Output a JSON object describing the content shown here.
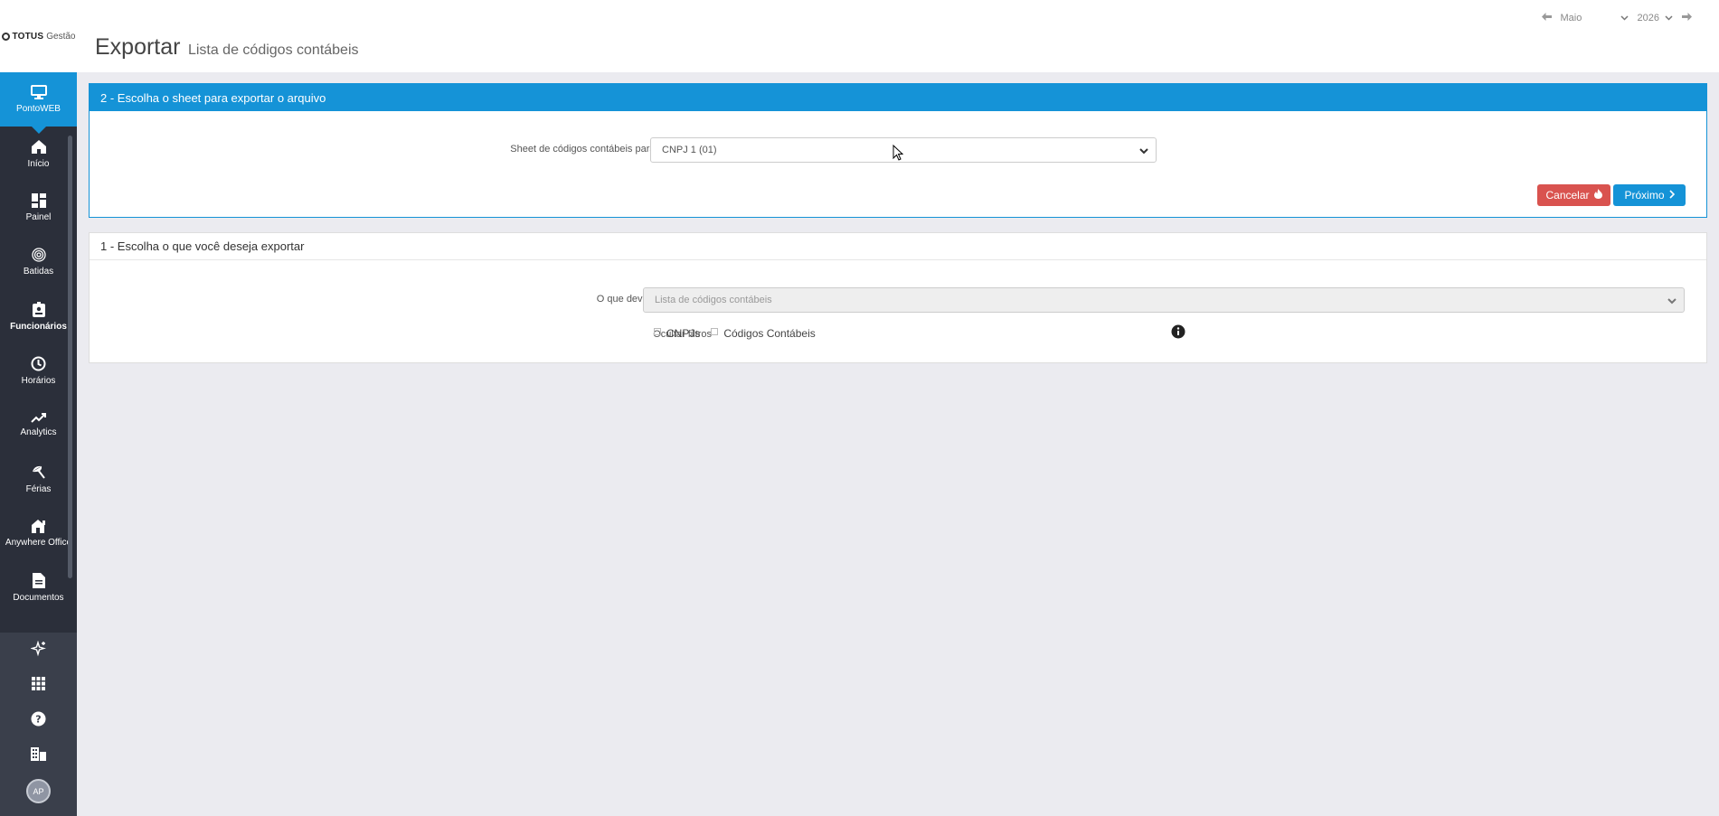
{
  "brand": {
    "name_bold": "TOTUS",
    "name_light": "Gestão"
  },
  "sidebar": {
    "active": {
      "label": "PontoWEB",
      "icon": "monitor-icon"
    },
    "items": [
      {
        "label": "Início",
        "icon": "home-icon"
      },
      {
        "label": "Painel",
        "icon": "dashboard-icon"
      },
      {
        "label": "Batidas",
        "icon": "fingerprint-icon"
      },
      {
        "label": "Funcionários",
        "icon": "badge-icon"
      },
      {
        "label": "Horários",
        "icon": "clock-icon"
      },
      {
        "label": "Analytics",
        "icon": "trend-icon"
      },
      {
        "label": "Férias",
        "icon": "beach-umbrella-icon"
      },
      {
        "label": "Anywhere Office",
        "icon": "home-office-icon"
      },
      {
        "label": "Documentos",
        "icon": "document-icon"
      }
    ],
    "bottom": [
      "sparkle-icon",
      "apps-grid-icon",
      "help-icon",
      "building-icon"
    ],
    "avatar_initials": "AP"
  },
  "header": {
    "title": "Exportar",
    "subtitle": "Lista de códigos contábeis",
    "month": "Maio",
    "year": "2026"
  },
  "step2": {
    "heading": "2 - Escolha o sheet para exportar o arquivo",
    "sheet_label": "Sheet de códigos contábeis para exportação",
    "sheet_value": "CNPJ 1 (01)",
    "cancel_label": "Cancelar",
    "next_label": "Próximo"
  },
  "step1": {
    "heading": "1 - Escolha o que você deseja exportar",
    "export_label": "O que deve ser exportado",
    "export_value": "Lista de códigos contábeis",
    "hide_filters_label": "Ocultar filtros",
    "filters": [
      "CNPJs",
      "Códigos Contábeis"
    ]
  },
  "colors": {
    "primary": "#1593d7",
    "danger": "#d9534f",
    "sidebar": "#2b2f3a"
  }
}
